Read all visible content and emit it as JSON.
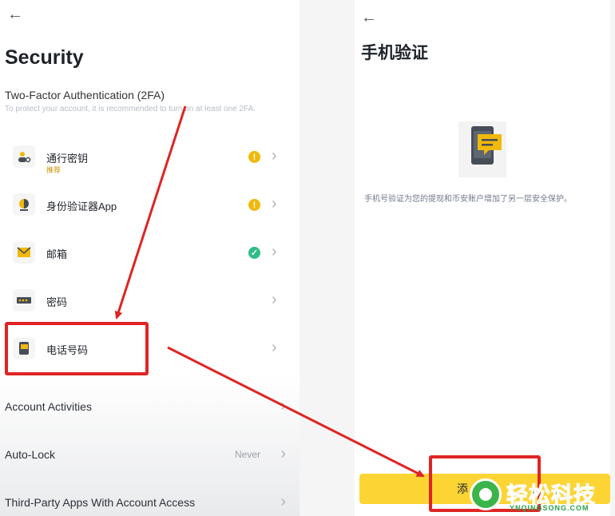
{
  "left": {
    "back_icon": "arrow-left",
    "title": "Security",
    "section_title": "Two-Factor Authentication (2FA)",
    "section_subtitle": "To protect your account, it is recommended to turn on at least one 2FA.",
    "items": [
      {
        "label": "通行密钥",
        "sublabel": "推荐",
        "icon": "passkey-icon",
        "status": "!"
      },
      {
        "label": "身份验证器App",
        "icon": "authenticator-icon",
        "status": "!"
      },
      {
        "label": "邮箱",
        "icon": "email-icon",
        "status": "✓"
      },
      {
        "label": "密码",
        "icon": "password-icon"
      },
      {
        "label": "电话号码",
        "icon": "phone-icon"
      }
    ],
    "account_activities": "Account Activities",
    "auto_lock": "Auto-Lock",
    "auto_lock_value": "Never",
    "third_party": "Third-Party Apps With Account Access"
  },
  "right": {
    "back_icon": "arrow-left",
    "title": "手机验证",
    "description": "手机号验证为您的提现和币安账户增加了另一层安全保护。",
    "button_label": "添"
  },
  "watermark": {
    "text": "轻松科技",
    "subtext": "YNQINGSONG.COM"
  },
  "colors": {
    "accent": "#fcd535",
    "warning": "#f0b90b",
    "success": "#2ebd85",
    "annotation": "#e02424"
  }
}
